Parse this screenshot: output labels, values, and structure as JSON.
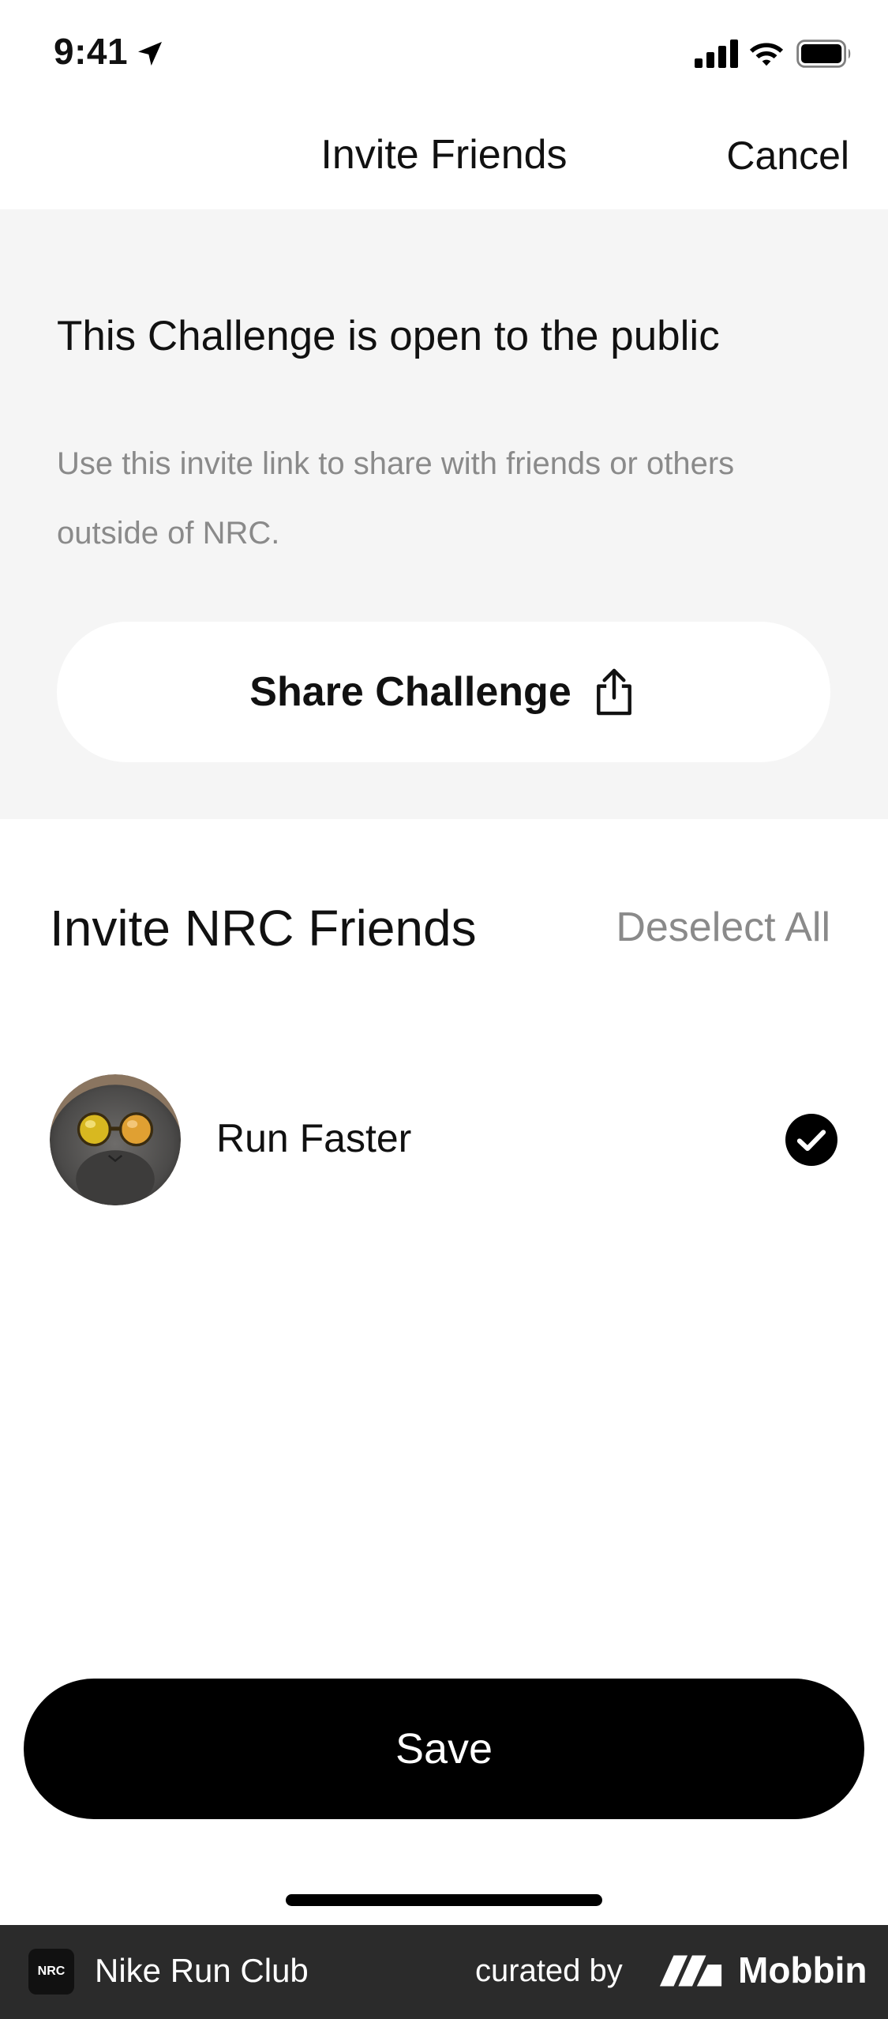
{
  "status_bar": {
    "time": "9:41"
  },
  "nav": {
    "title": "Invite Friends",
    "cancel_label": "Cancel"
  },
  "public_section": {
    "title": "This Challenge is open to the public",
    "description": "Use this invite link to share with friends or others outside of NRC.",
    "share_button_label": "Share Challenge"
  },
  "invite_section": {
    "title": "Invite NRC Friends",
    "deselect_label": "Deselect All",
    "friends": [
      {
        "name": "Run Faster",
        "selected": true
      }
    ]
  },
  "save_button_label": "Save",
  "footer": {
    "app_name": "Nike Run Club",
    "app_logo_text": "NRC",
    "curated_by": "curated by",
    "brand": "Mobbin"
  }
}
